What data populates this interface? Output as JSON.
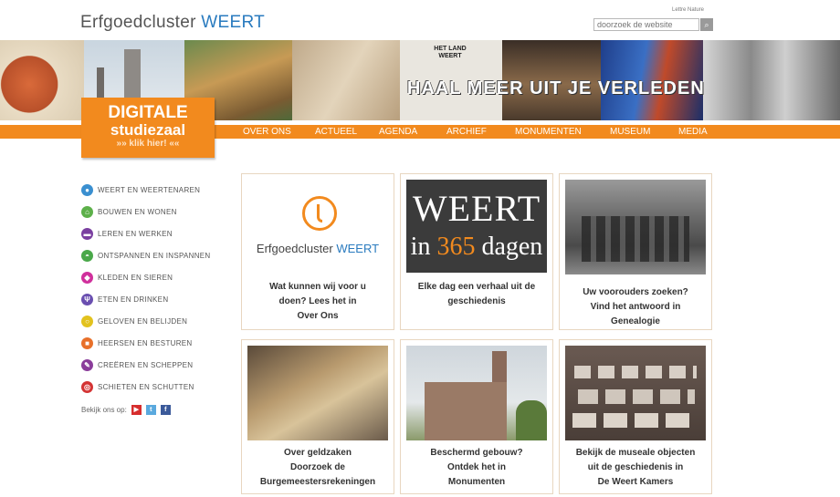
{
  "header": {
    "logo_main": "Erfgoedcluster ",
    "logo_accent": "WEERT",
    "util_link": "Lettre Nature",
    "search_placeholder": "doorzoek de website",
    "search_button_icon": "search-icon"
  },
  "banner": {
    "text": "HAAL MEER UIT JE VERLEDEN",
    "newspaper_text": "HET LAND WEERT"
  },
  "digitale": {
    "line1": "DIGITALE",
    "line2": "studiezaal",
    "line3": "»» klik hier! ««"
  },
  "nav": [
    "OVER ONS",
    "ACTUEEL",
    "AGENDA",
    "ARCHIEF",
    "MONUMENTEN",
    "MUSEUM",
    "MEDIA"
  ],
  "sidebar": {
    "items": [
      {
        "label": "WEERT EN WEERTENAREN",
        "color": "#3a8fd0"
      },
      {
        "label": "BOUWEN EN WONEN",
        "color": "#5db04a"
      },
      {
        "label": "LEREN EN WERKEN",
        "color": "#7a3fa0"
      },
      {
        "label": "ONTSPANNEN EN INSPANNEN",
        "color": "#4aa84a"
      },
      {
        "label": "KLEDEN EN SIEREN",
        "color": "#d0309c"
      },
      {
        "label": "ETEN EN DRINKEN",
        "color": "#6a4fb0"
      },
      {
        "label": "GELOVEN EN BELIJDEN",
        "color": "#e2c21e"
      },
      {
        "label": "HEERSEN EN BESTUREN",
        "color": "#e8702a"
      },
      {
        "label": "CREËREN EN SCHEPPEN",
        "color": "#8a3c9a"
      },
      {
        "label": "SCHIETEN EN SCHUTTEN",
        "color": "#d43434"
      }
    ],
    "social_label": "Bekijk ons op:",
    "social_icons": [
      "youtube-icon",
      "twitter-icon",
      "facebook-icon"
    ]
  },
  "tiles": {
    "t1": {
      "logo_main": "Erfgoedcluster ",
      "logo_accent": "WEERT",
      "caption": [
        "Wat kunnen wij voor u",
        "doen? Lees het in",
        "Over Ons"
      ]
    },
    "t2": {
      "line1": "WEERT",
      "line2_num": "365",
      "line2_pre": "in ",
      "line2_post": " dagen",
      "caption": [
        "Elke dag een verhaal uit de",
        "geschiedenis"
      ]
    },
    "t3": {
      "caption": [
        "Uw voorouders zoeken?",
        "Vind het antwoord in",
        "Genealogie"
      ]
    },
    "t4": {
      "caption": [
        "Over geldzaken",
        "Doorzoek de",
        "Burgemeestersrekeningen"
      ]
    },
    "t5": {
      "caption": [
        "Beschermd gebouw?",
        "Ontdek het in",
        "Monumenten"
      ]
    },
    "t6": {
      "caption": [
        "Bekijk de museale objecten",
        "uit de geschiedenis in",
        "De Weert Kamers"
      ]
    }
  },
  "colors": {
    "accent": "#f28a1e",
    "brand_blue": "#2a7bbf"
  }
}
